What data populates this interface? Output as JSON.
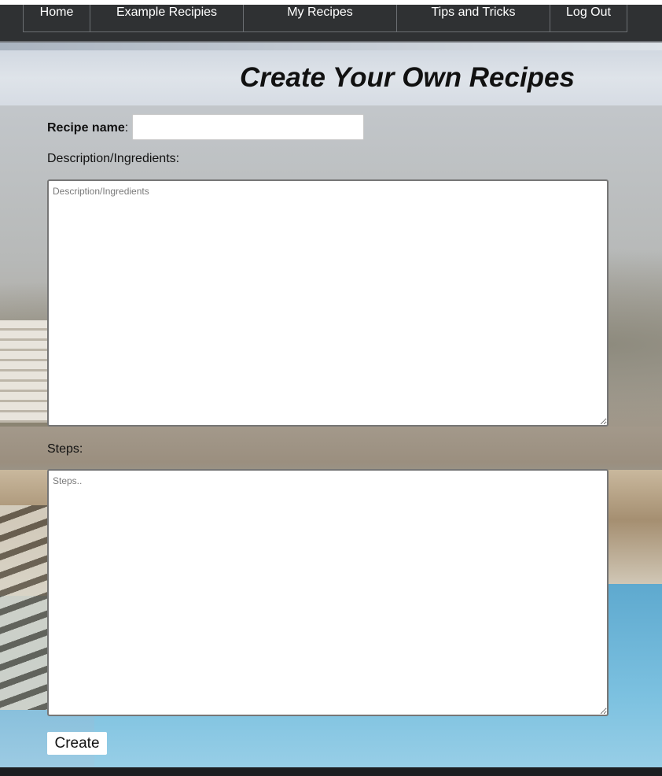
{
  "nav": {
    "items": [
      {
        "label": "Home"
      },
      {
        "label": "Example Recipies"
      },
      {
        "label": "My Recipes"
      },
      {
        "label": "Tips and Tricks"
      },
      {
        "label": "Log Out"
      }
    ]
  },
  "header": {
    "title": "Create Your Own Recipes"
  },
  "form": {
    "recipe_name_label": "Recipe name",
    "recipe_name_colon": ":",
    "recipe_name_value": "",
    "description_label": "Description/Ingredients:",
    "description_placeholder": "Description/Ingredients",
    "steps_label": "Steps:",
    "steps_placeholder": "Steps..",
    "create_label": "Create"
  },
  "colors": {
    "nav_bg": "#2f3133",
    "nav_text": "#ffffff",
    "title_text": "#111111"
  }
}
